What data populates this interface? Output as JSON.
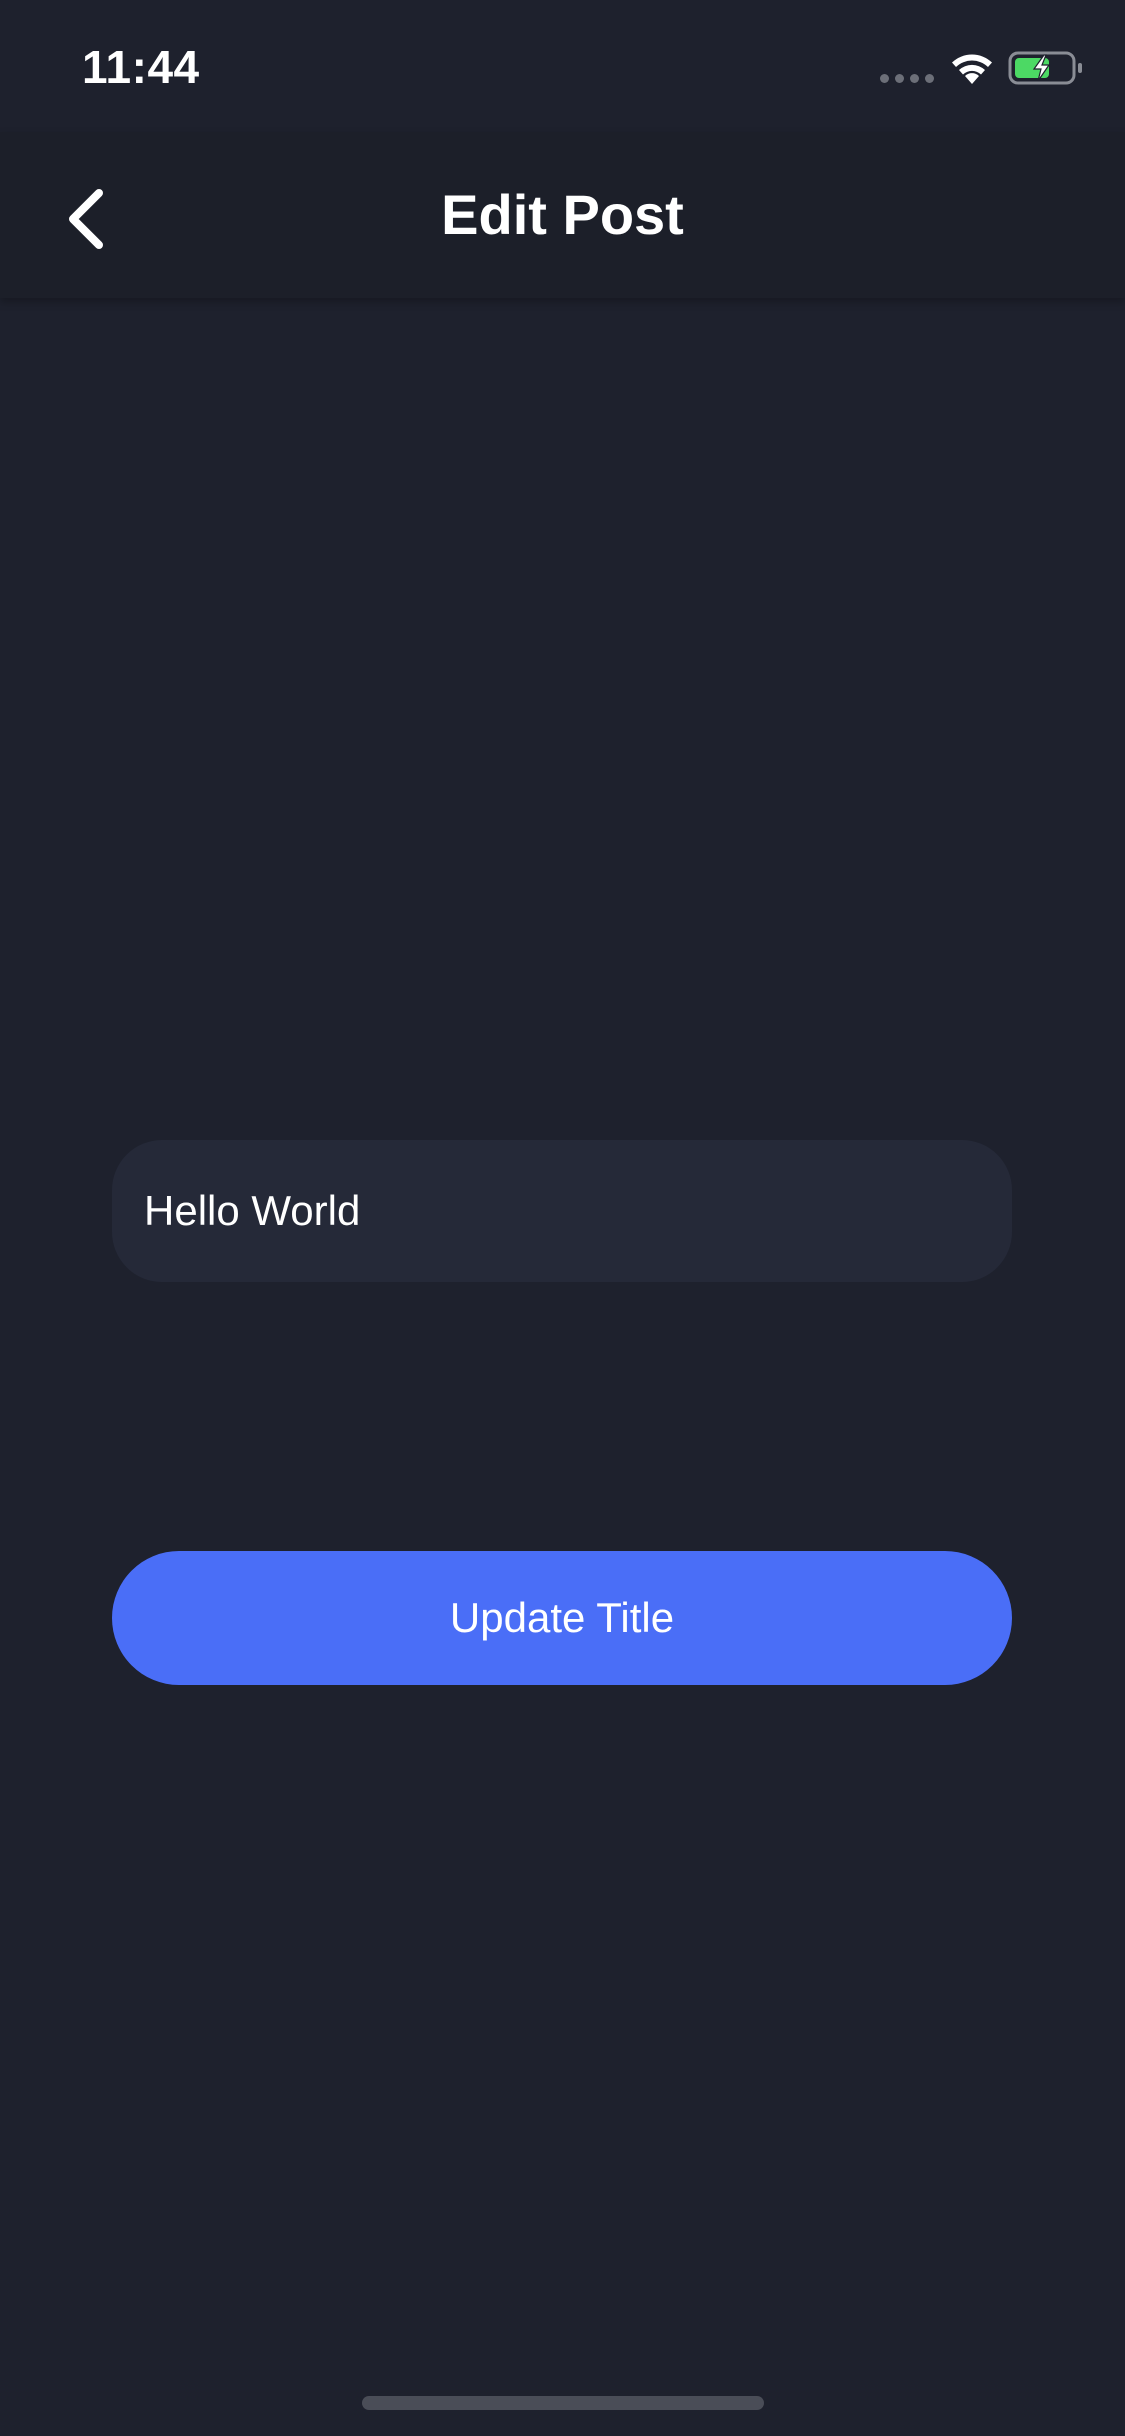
{
  "status_bar": {
    "time": "11:44",
    "icons": [
      "signal-dots-icon",
      "wifi-icon",
      "battery-charging-icon"
    ]
  },
  "nav": {
    "title": "Edit Post",
    "back_icon": "chevron-left-icon"
  },
  "form": {
    "title_input_value": "Hello World",
    "update_button_label": "Update Title"
  },
  "colors": {
    "background": "#1e212d",
    "nav_background": "#1c1f29",
    "input_background": "#252938",
    "button_accent": "#4a6ef7",
    "battery_fill": "#4cd964"
  }
}
